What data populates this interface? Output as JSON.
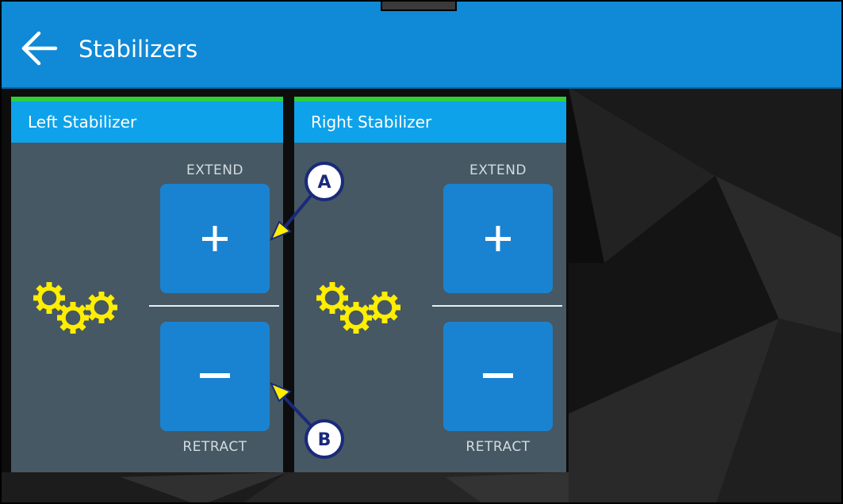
{
  "header": {
    "title": "Stabilizers",
    "back_icon": "arrow-left-icon"
  },
  "panels": [
    {
      "title": "Left Stabilizer",
      "extend_label": "EXTEND",
      "retract_label": "RETRACT",
      "extend_symbol": "+",
      "retract_symbol": "−",
      "icon": "gears-icon"
    },
    {
      "title": "Right Stabilizer",
      "extend_label": "EXTEND",
      "retract_label": "RETRACT",
      "extend_symbol": "+",
      "retract_symbol": "−",
      "icon": "gears-icon"
    }
  ],
  "callouts": [
    {
      "letter": "A"
    },
    {
      "letter": "B"
    }
  ],
  "colors": {
    "header": "#1089d6",
    "panel_header": "#0ea2ea",
    "panel_body": "#465863",
    "status_bar": "#2fcf3a",
    "button": "#1a83d1",
    "gear": "#ffee00",
    "callout_fill": "#ffffff",
    "callout_border": "#1a2a7a",
    "arrow": "#ffee00"
  }
}
